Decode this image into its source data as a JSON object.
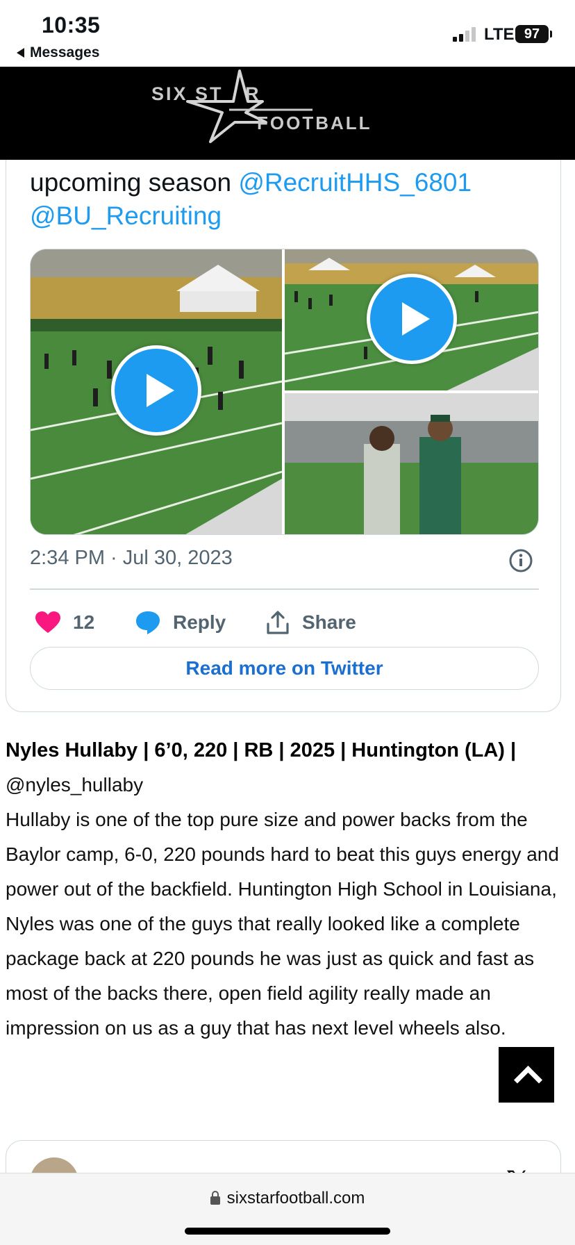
{
  "status_bar": {
    "time": "10:35",
    "back_label": "Messages",
    "network": "LTE",
    "battery": "97"
  },
  "site": {
    "logo_line1": "SIX ST",
    "logo_line1b": "R",
    "logo_line2": "FOOTBALL",
    "url": "sixstarfootball.com"
  },
  "tweet": {
    "text_prefix": "upcoming season ",
    "mention1": "@RecruitHHS_6801",
    "mention2": "@BU_Recruiting",
    "timestamp": "2:34 PM · Jul 30, 2023",
    "likes": "12",
    "reply_label": "Reply",
    "share_label": "Share",
    "read_more": "Read more on Twitter",
    "colors": {
      "like": "#f91880",
      "reply": "#1d9bf0",
      "link": "#1d9bf0"
    }
  },
  "article": {
    "headline": "Nyles Hullaby | 6’0, 220 | RB | 2025 | Huntington (LA) |",
    "handle": "@nyles_hullaby",
    "body": "Hullaby is one of the top pure size and power backs from the Baylor camp, 6-0, 220 pounds hard to beat this guys energy and power out of the backfield. Huntington High School in Louisiana, Nyles was one of the guys that really looked like a complete package back at 220 pounds he was just as quick and fast as most of the backs there, open field agility really made an impression on us as a guy that has next level wheels also."
  },
  "next_card": {
    "logo": "𝕏"
  }
}
